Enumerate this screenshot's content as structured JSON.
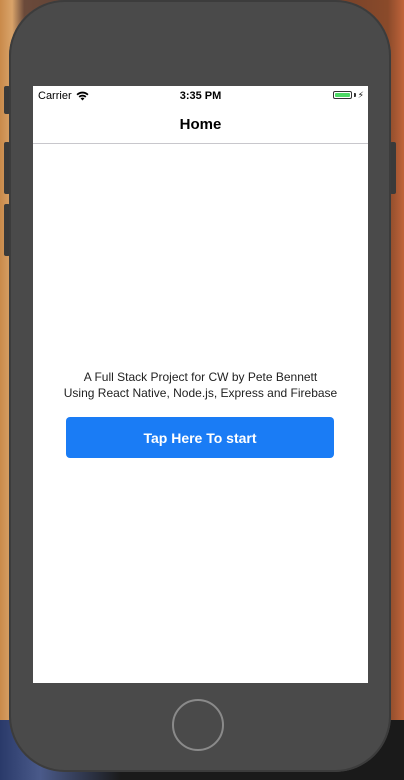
{
  "status_bar": {
    "carrier": "Carrier",
    "time": "3:35 PM",
    "battery_color": "#4cd964"
  },
  "nav": {
    "title": "Home"
  },
  "main": {
    "line1": "A Full Stack Project for CW by Pete Bennett",
    "line2": "Using React Native, Node.js, Express and Firebase",
    "start_button_label": "Tap Here To start",
    "accent_color": "#1a7cf5"
  },
  "icons": {
    "wifi": "wifi-icon",
    "battery": "battery-icon",
    "charging": "bolt-icon"
  }
}
